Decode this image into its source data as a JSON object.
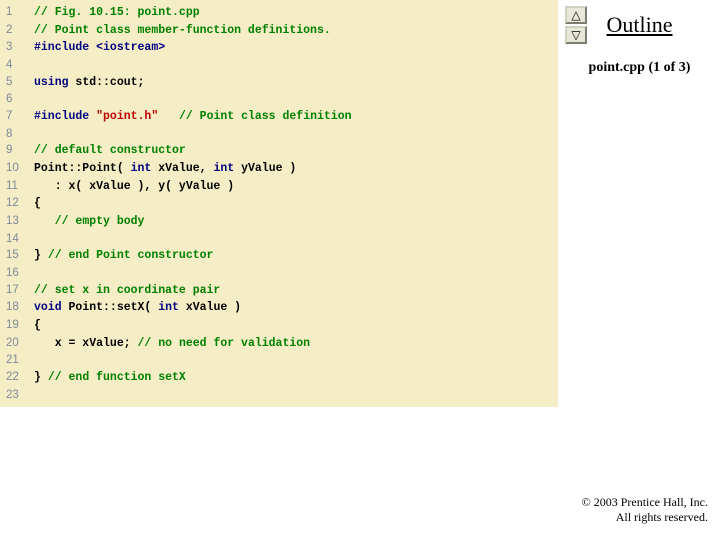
{
  "lines": [
    {
      "n": "1",
      "tokens": [
        [
          "comment",
          "// Fig. 10.15: point.cpp"
        ]
      ]
    },
    {
      "n": "2",
      "tokens": [
        [
          "comment",
          "// Point class member-function definitions."
        ]
      ]
    },
    {
      "n": "3",
      "tokens": [
        [
          "pp",
          "#include <iostream>"
        ]
      ]
    },
    {
      "n": "4",
      "tokens": [
        [
          "plain",
          ""
        ]
      ]
    },
    {
      "n": "5",
      "tokens": [
        [
          "kw",
          "using"
        ],
        [
          "plain",
          " std::cout;"
        ]
      ]
    },
    {
      "n": "6",
      "tokens": [
        [
          "plain",
          ""
        ]
      ]
    },
    {
      "n": "7",
      "tokens": [
        [
          "pp",
          "#include "
        ],
        [
          "str",
          "\"point.h\""
        ],
        [
          "plain",
          "   "
        ],
        [
          "comment",
          "// Point class definition"
        ]
      ]
    },
    {
      "n": "8",
      "tokens": [
        [
          "plain",
          ""
        ]
      ]
    },
    {
      "n": "9",
      "tokens": [
        [
          "comment",
          "// default constructor"
        ]
      ]
    },
    {
      "n": "10",
      "tokens": [
        [
          "plain",
          "Point::Point( "
        ],
        [
          "kw",
          "int"
        ],
        [
          "plain",
          " xValue, "
        ],
        [
          "kw",
          "int"
        ],
        [
          "plain",
          " yValue )"
        ]
      ]
    },
    {
      "n": "11",
      "tokens": [
        [
          "plain",
          "   : x( xValue ), y( yValue )"
        ]
      ]
    },
    {
      "n": "12",
      "tokens": [
        [
          "plain",
          "{"
        ]
      ]
    },
    {
      "n": "13",
      "tokens": [
        [
          "plain",
          "   "
        ],
        [
          "comment",
          "// empty body"
        ]
      ]
    },
    {
      "n": "14",
      "tokens": [
        [
          "plain",
          ""
        ]
      ]
    },
    {
      "n": "15",
      "tokens": [
        [
          "plain",
          "} "
        ],
        [
          "comment",
          "// end Point constructor"
        ]
      ]
    },
    {
      "n": "16",
      "tokens": [
        [
          "plain",
          ""
        ]
      ]
    },
    {
      "n": "17",
      "tokens": [
        [
          "comment",
          "// set x in coordinate pair"
        ]
      ]
    },
    {
      "n": "18",
      "tokens": [
        [
          "kw",
          "void"
        ],
        [
          "plain",
          " Point::setX( "
        ],
        [
          "kw",
          "int"
        ],
        [
          "plain",
          " xValue )"
        ]
      ]
    },
    {
      "n": "19",
      "tokens": [
        [
          "plain",
          "{"
        ]
      ]
    },
    {
      "n": "20",
      "tokens": [
        [
          "plain",
          "   x = xValue; "
        ],
        [
          "comment",
          "// no need for validation"
        ]
      ]
    },
    {
      "n": "21",
      "tokens": [
        [
          "plain",
          ""
        ]
      ]
    },
    {
      "n": "22",
      "tokens": [
        [
          "plain",
          "} "
        ],
        [
          "comment",
          "// end function setX"
        ]
      ]
    },
    {
      "n": "23",
      "tokens": [
        [
          "plain",
          ""
        ]
      ]
    }
  ],
  "outline": {
    "title": "Outline",
    "subtitle": "point.cpp (1 of 3)"
  },
  "nav": {
    "up_glyph": "△",
    "down_glyph": "▽"
  },
  "copyright": {
    "line1": "© 2003 Prentice Hall, Inc.",
    "line2": "All rights reserved."
  }
}
